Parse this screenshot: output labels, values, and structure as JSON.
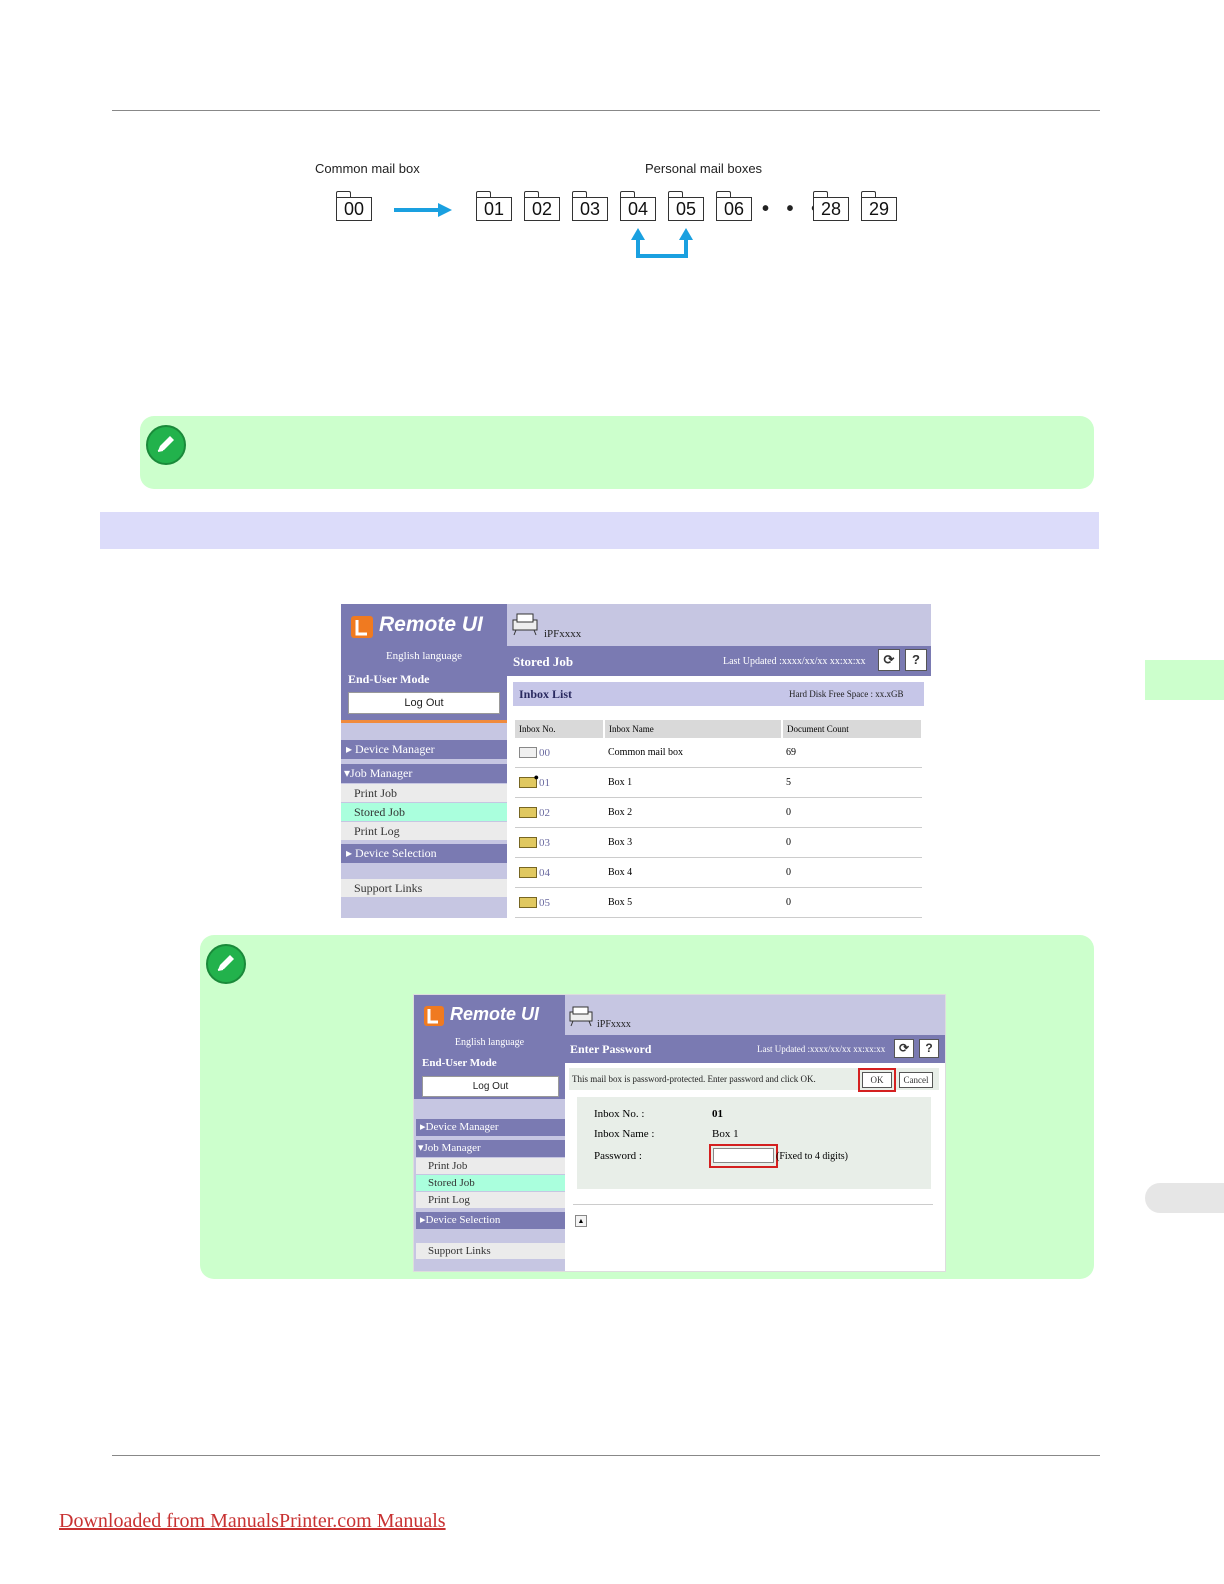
{
  "diagram": {
    "common_label": "Common mail box",
    "personal_label": "Personal mail boxes",
    "common_box": "00",
    "personal_boxes": [
      "01",
      "02",
      "03",
      "04",
      "05",
      "06"
    ],
    "ellipsis": "• • •",
    "last_boxes": [
      "28",
      "29"
    ],
    "arrow_color": "#1aa0e0"
  },
  "screenshot1": {
    "logo": "Remote UI",
    "language": "English language",
    "mode": "End-User Mode",
    "logout": "Log Out",
    "printer": "iPFxxxx",
    "page_title": "Stored Job",
    "last_updated": "Last Updated :xxxx/xx/xx xx:xx:xx",
    "refresh_icon": "refresh-icon",
    "help": "?",
    "menu": {
      "device_manager": "Device Manager",
      "job_manager": "Job Manager",
      "print_job": "Print Job",
      "stored_job": "Stored Job",
      "print_log": "Print Log",
      "device_selection": "Device Selection",
      "support_links": "Support Links"
    },
    "inbox_title": "Inbox List",
    "disk_space": "Hard Disk Free Space : xx.xGB",
    "columns": [
      "Inbox No.",
      "Inbox Name",
      "Document Count"
    ],
    "rows": [
      {
        "no": "00",
        "name": "Common mail box",
        "count": "69"
      },
      {
        "no": "01",
        "name": "Box 1",
        "count": "5"
      },
      {
        "no": "02",
        "name": "Box 2",
        "count": "0"
      },
      {
        "no": "03",
        "name": "Box 3",
        "count": "0"
      },
      {
        "no": "04",
        "name": "Box 4",
        "count": "0"
      },
      {
        "no": "05",
        "name": "Box 5",
        "count": "0"
      }
    ]
  },
  "screenshot2": {
    "logo": "Remote UI",
    "language": "English language",
    "mode": "End-User Mode",
    "logout": "Log Out",
    "printer": "iPFxxxx",
    "page_title": "Enter Password",
    "last_updated": "Last Updated :xxxx/xx/xx xx:xx:xx",
    "help": "?",
    "menu": {
      "device_manager": "Device Manager",
      "job_manager": "Job Manager",
      "print_job": "Print Job",
      "stored_job": "Stored Job",
      "print_log": "Print Log",
      "device_selection": "Device Selection",
      "support_links": "Support Links"
    },
    "message": "This mail box is password-protected. Enter password and click OK.",
    "ok": "OK",
    "cancel": "Cancel",
    "inbox_no_label": "Inbox No. :",
    "inbox_no_value": "01",
    "inbox_name_label": "Inbox Name :",
    "inbox_name_value": "Box 1",
    "password_label": "Password :",
    "password_hint": "(Fixed to 4 digits)",
    "highlight_color": "#d42020"
  },
  "footer": {
    "link": "Downloaded from ManualsPrinter.com Manuals"
  }
}
